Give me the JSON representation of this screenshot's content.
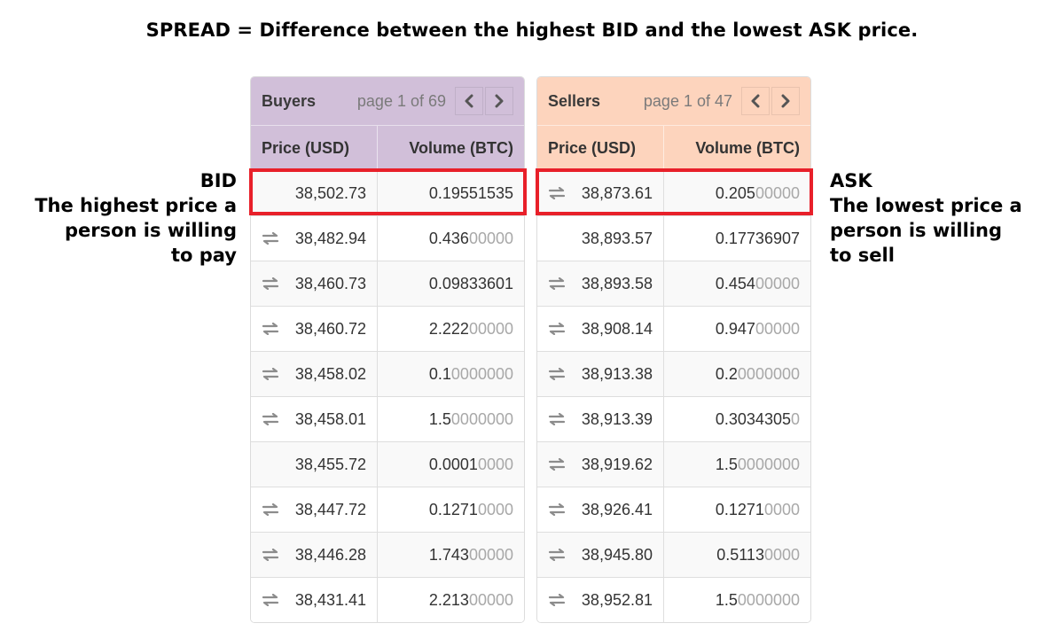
{
  "headline": "SPREAD = Difference between the highest BID and the lowest ASK price.",
  "annotations": {
    "bid": {
      "title": "BID",
      "lines": [
        "The highest price a",
        "person is willing",
        "to pay"
      ]
    },
    "ask": {
      "title": "ASK",
      "lines": [
        "The lowest price a",
        "person is willing",
        "to sell"
      ]
    }
  },
  "colors": {
    "buyers_header": "#d1bfd9",
    "sellers_header": "#fdd4bd",
    "highlight": "#e8202a"
  },
  "buyers": {
    "title": "Buyers",
    "page_info": "page 1 of 69",
    "prev_icon": "chevron-left-icon",
    "next_icon": "chevron-right-icon",
    "columns": [
      "Price (USD)",
      "Volume (BTC)"
    ],
    "rows": [
      {
        "icon": false,
        "price": "38,502.73",
        "vol_main": "0.19551535",
        "vol_dim": ""
      },
      {
        "icon": true,
        "price": "38,482.94",
        "vol_main": "0.436",
        "vol_dim": "00000"
      },
      {
        "icon": true,
        "price": "38,460.73",
        "vol_main": "0.09833601",
        "vol_dim": ""
      },
      {
        "icon": true,
        "price": "38,460.72",
        "vol_main": "2.222",
        "vol_dim": "00000"
      },
      {
        "icon": true,
        "price": "38,458.02",
        "vol_main": "0.1",
        "vol_dim": "0000000"
      },
      {
        "icon": true,
        "price": "38,458.01",
        "vol_main": "1.5",
        "vol_dim": "0000000"
      },
      {
        "icon": false,
        "price": "38,455.72",
        "vol_main": "0.0001",
        "vol_dim": "0000"
      },
      {
        "icon": true,
        "price": "38,447.72",
        "vol_main": "0.1271",
        "vol_dim": "0000"
      },
      {
        "icon": true,
        "price": "38,446.28",
        "vol_main": "1.743",
        "vol_dim": "00000"
      },
      {
        "icon": true,
        "price": "38,431.41",
        "vol_main": "2.213",
        "vol_dim": "00000"
      }
    ]
  },
  "sellers": {
    "title": "Sellers",
    "page_info": "page 1 of 47",
    "prev_icon": "chevron-left-icon",
    "next_icon": "chevron-right-icon",
    "columns": [
      "Price (USD)",
      "Volume (BTC)"
    ],
    "rows": [
      {
        "icon": true,
        "price": "38,873.61",
        "vol_main": "0.205",
        "vol_dim": "00000"
      },
      {
        "icon": false,
        "price": "38,893.57",
        "vol_main": "0.17736907",
        "vol_dim": ""
      },
      {
        "icon": true,
        "price": "38,893.58",
        "vol_main": "0.454",
        "vol_dim": "00000"
      },
      {
        "icon": true,
        "price": "38,908.14",
        "vol_main": "0.947",
        "vol_dim": "00000"
      },
      {
        "icon": true,
        "price": "38,913.38",
        "vol_main": "0.2",
        "vol_dim": "0000000"
      },
      {
        "icon": true,
        "price": "38,913.39",
        "vol_main": "0.3034305",
        "vol_dim": "0"
      },
      {
        "icon": true,
        "price": "38,919.62",
        "vol_main": "1.5",
        "vol_dim": "0000000"
      },
      {
        "icon": true,
        "price": "38,926.41",
        "vol_main": "0.1271",
        "vol_dim": "0000"
      },
      {
        "icon": true,
        "price": "38,945.80",
        "vol_main": "0.5113",
        "vol_dim": "0000"
      },
      {
        "icon": true,
        "price": "38,952.81",
        "vol_main": "1.5",
        "vol_dim": "0000000"
      }
    ]
  }
}
